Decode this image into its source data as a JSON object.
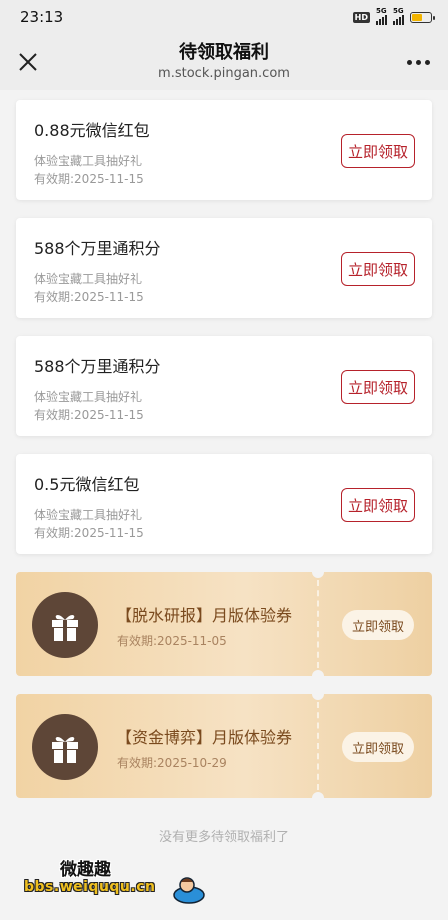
{
  "status_bar": {
    "time": "23:13",
    "hd_label": "HD",
    "sim1_label": "5G",
    "sim2_label": "5G",
    "battery_color": "#f2b400"
  },
  "nav": {
    "title": "待领取福利",
    "subtitle": "m.stock.pingan.com",
    "close_icon": "close-icon",
    "more_icon": "more-icon"
  },
  "rewards": [
    {
      "title": "0.88元微信红包",
      "desc": "体验宝藏工具抽好礼",
      "expiry": "有效期:2025-11-15",
      "button": "立即领取"
    },
    {
      "title": "588个万里通积分",
      "desc": "体验宝藏工具抽好礼",
      "expiry": "有效期:2025-11-15",
      "button": "立即领取"
    },
    {
      "title": "588个万里通积分",
      "desc": "体验宝藏工具抽好礼",
      "expiry": "有效期:2025-11-15",
      "button": "立即领取"
    },
    {
      "title": "0.5元微信红包",
      "desc": "体验宝藏工具抽好礼",
      "expiry": "有效期:2025-11-15",
      "button": "立即领取"
    }
  ],
  "coupons": [
    {
      "title": "【脱水研报】月版体验券",
      "expiry": "有效期:2025-11-05",
      "button": "立即领取",
      "icon": "gift-icon"
    },
    {
      "title": "【资金博弈】月版体验券",
      "expiry": "有效期:2025-10-29",
      "button": "立即领取",
      "icon": "gift-icon"
    }
  ],
  "footer": {
    "note": "没有更多待领取福利了"
  },
  "watermark": {
    "top": "微趣趣",
    "bottom": "bbs.weiququ.cn"
  },
  "colors": {
    "accent_red": "#b6222b",
    "coupon_gold": "#f1d3a4",
    "coupon_text": "#7a4a1e"
  }
}
